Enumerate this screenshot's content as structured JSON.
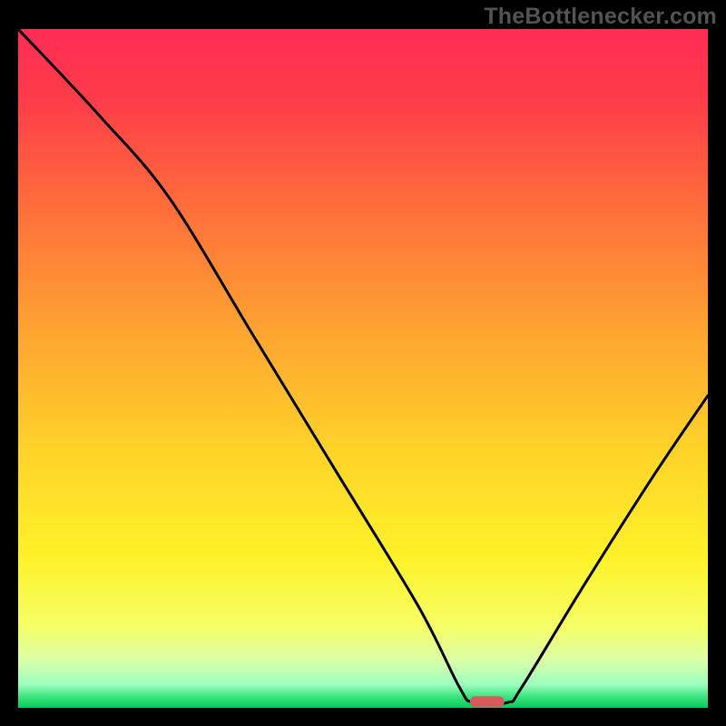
{
  "watermark": "TheBottleneсker.com",
  "chart_data": {
    "type": "line",
    "title": "",
    "xlabel": "",
    "ylabel": "",
    "xlim": [
      0,
      100
    ],
    "ylim": [
      0,
      100
    ],
    "note": "Black V-shaped curve descending from top-left to a minimum around x≈68 then rising toward the right edge. Background is a vertical red→yellow→green gradient with thin bright-green floor band. Small rounded red marker sits on the baseline at the curve minimum.",
    "curve_points": [
      {
        "x": 0,
        "y": 100
      },
      {
        "x": 12,
        "y": 87
      },
      {
        "x": 22,
        "y": 75
      },
      {
        "x": 34,
        "y": 55
      },
      {
        "x": 46,
        "y": 35
      },
      {
        "x": 58,
        "y": 15
      },
      {
        "x": 64,
        "y": 3
      },
      {
        "x": 66,
        "y": 0.8
      },
      {
        "x": 71,
        "y": 0.8
      },
      {
        "x": 73,
        "y": 3
      },
      {
        "x": 82,
        "y": 18
      },
      {
        "x": 92,
        "y": 34
      },
      {
        "x": 100,
        "y": 46
      }
    ],
    "marker": {
      "x_center": 68,
      "width": 5,
      "y": 0.9,
      "color": "#d85a5a"
    },
    "gradient_stops": [
      {
        "offset": 0.0,
        "color": "#ff2d55"
      },
      {
        "offset": 0.1,
        "color": "#ff3b4a"
      },
      {
        "offset": 0.25,
        "color": "#ff6a3c"
      },
      {
        "offset": 0.45,
        "color": "#ffa531"
      },
      {
        "offset": 0.62,
        "color": "#ffd32a"
      },
      {
        "offset": 0.78,
        "color": "#fff229"
      },
      {
        "offset": 0.88,
        "color": "#f6ff66"
      },
      {
        "offset": 0.93,
        "color": "#daffa8"
      },
      {
        "offset": 0.965,
        "color": "#9fffbf"
      },
      {
        "offset": 0.985,
        "color": "#35e27a"
      },
      {
        "offset": 1.0,
        "color": "#08c95a"
      }
    ]
  }
}
